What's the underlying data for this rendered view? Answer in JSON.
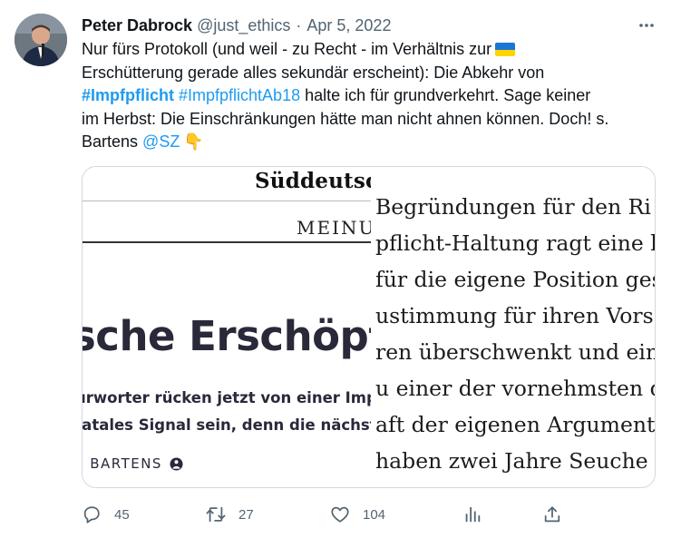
{
  "author": {
    "name": "Peter Dabrock",
    "handle": "@just_ethics",
    "separator": "·",
    "date": "Apr 5, 2022"
  },
  "tweet": {
    "line1": "Nur fürs Protokoll (und weil - zu Recht - im Verhältnis zur",
    "line2": "Erschütterung gerade alles sekundär erscheint): Die Abkehr von",
    "hashtag1": "#Impfpflicht",
    "hashtag2": "#ImpfpflichtAb18",
    "line3_rest": " halte ich für grundverkehrt. Sage keiner",
    "line4": "im Herbst: Die Einschränkungen hätte man nicht ahnen können. Doch! s.",
    "line5_start": "Bartens ",
    "mention": "@SZ",
    "emoji": "👇"
  },
  "media": {
    "left": {
      "masthead": "Süddeutsche",
      "section": "MEINU",
      "headline": "sche Erschöpf",
      "teaser_line1": "urworter rücken jetzt von einer Impf",
      "teaser_line2": "fatales Signal sein, denn die nächst",
      "author_line": "R BARTENS"
    },
    "right": {
      "lines": [
        "Begründungen für den Ri",
        "pflicht-Haltung ragt eine b",
        "für die eigene Position ges",
        "ustimmung für ihren Vors",
        "ren überschwenkt und eine",
        "u einer der vornehmsten d",
        "aft der eigenen Argumente",
        "haben zwei Jahre Seuche ge"
      ]
    }
  },
  "actions": {
    "reply_count": "45",
    "retweet_count": "27",
    "like_count": "104"
  },
  "colors": {
    "link": "#1d9bf0",
    "secondary_text": "#536471",
    "border": "#cfd9de"
  }
}
